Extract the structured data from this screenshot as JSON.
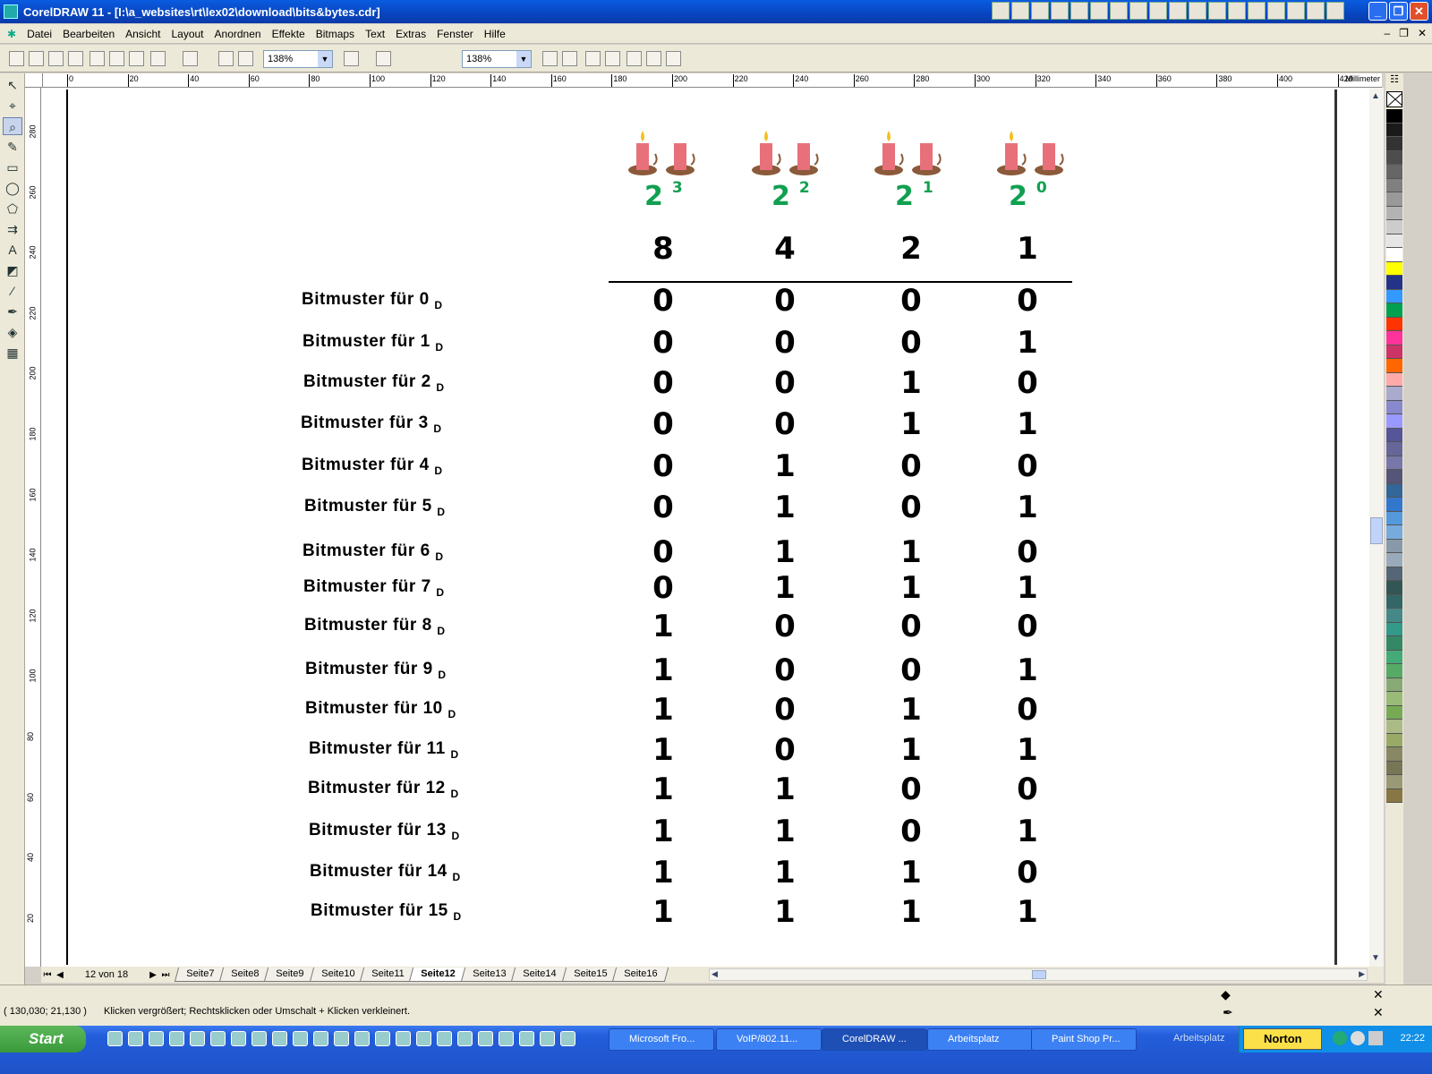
{
  "window": {
    "title": "CorelDRAW 11 - [I:\\a_websites\\rt\\lex02\\download\\bits&bytes.cdr]"
  },
  "menu": [
    "Datei",
    "Bearbeiten",
    "Ansicht",
    "Layout",
    "Anordnen",
    "Effekte",
    "Bitmaps",
    "Text",
    "Extras",
    "Fenster",
    "Hilfe"
  ],
  "toolbar": {
    "zoom1": "138%",
    "zoom2": "138%"
  },
  "ruler": {
    "unit": "Millimeter",
    "h_labels": [
      "0",
      "20",
      "40",
      "60",
      "80",
      "100",
      "120",
      "140",
      "160",
      "180",
      "200",
      "220",
      "240",
      "260",
      "280",
      "300",
      "320",
      "340",
      "360",
      "380",
      "400",
      "420"
    ],
    "v_labels": [
      "280",
      "260",
      "240",
      "220",
      "200",
      "180",
      "160",
      "140",
      "120",
      "100",
      "80",
      "60",
      "40",
      "20"
    ]
  },
  "document": {
    "powers": [
      {
        "base": "2",
        "exp": "3"
      },
      {
        "base": "2",
        "exp": "2"
      },
      {
        "base": "2",
        "exp": "1"
      },
      {
        "base": "2",
        "exp": "0"
      }
    ],
    "weights": [
      "8",
      "4",
      "2",
      "1"
    ],
    "rows": [
      {
        "label": "Bitmuster für 0",
        "sub": "D",
        "bits": [
          "0",
          "0",
          "0",
          "0"
        ]
      },
      {
        "label": "Bitmuster für 1",
        "sub": "D",
        "bits": [
          "0",
          "0",
          "0",
          "1"
        ]
      },
      {
        "label": "Bitmuster für 2",
        "sub": "D",
        "bits": [
          "0",
          "0",
          "1",
          "0"
        ]
      },
      {
        "label": "Bitmuster für 3",
        "sub": "D",
        "bits": [
          "0",
          "0",
          "1",
          "1"
        ]
      },
      {
        "label": "Bitmuster für 4",
        "sub": "D",
        "bits": [
          "0",
          "1",
          "0",
          "0"
        ]
      },
      {
        "label": "Bitmuster für 5",
        "sub": "D",
        "bits": [
          "0",
          "1",
          "0",
          "1"
        ]
      },
      {
        "label": "Bitmuster für 6",
        "sub": "D",
        "bits": [
          "0",
          "1",
          "1",
          "0"
        ]
      },
      {
        "label": "Bitmuster für 7",
        "sub": "D",
        "bits": [
          "0",
          "1",
          "1",
          "1"
        ]
      },
      {
        "label": "Bitmuster für 8",
        "sub": "D",
        "bits": [
          "1",
          "0",
          "0",
          "0"
        ]
      },
      {
        "label": "Bitmuster für 9",
        "sub": "D",
        "bits": [
          "1",
          "0",
          "0",
          "1"
        ]
      },
      {
        "label": "Bitmuster für 10",
        "sub": "D",
        "bits": [
          "1",
          "0",
          "1",
          "0"
        ]
      },
      {
        "label": "Bitmuster für 11",
        "sub": "D",
        "bits": [
          "1",
          "0",
          "1",
          "1"
        ]
      },
      {
        "label": "Bitmuster für 12",
        "sub": "D",
        "bits": [
          "1",
          "1",
          "0",
          "0"
        ]
      },
      {
        "label": "Bitmuster für 13",
        "sub": "D",
        "bits": [
          "1",
          "1",
          "0",
          "1"
        ]
      },
      {
        "label": "Bitmuster für 14",
        "sub": "D",
        "bits": [
          "1",
          "1",
          "1",
          "0"
        ]
      },
      {
        "label": "Bitmuster für 15",
        "sub": "D",
        "bits": [
          "1",
          "1",
          "1",
          "1"
        ]
      }
    ]
  },
  "pagenav": {
    "counter": "12 von 18",
    "tabs": [
      "Seite7",
      "Seite8",
      "Seite9",
      "Seite10",
      "Seite11",
      "Seite12",
      "Seite13",
      "Seite14",
      "Seite15",
      "Seite16"
    ],
    "active": "Seite12"
  },
  "status": {
    "coords": "( 130,030; 21,130 )",
    "hint": "Klicken vergrößert; Rechtsklicken oder Umschalt + Klicken verkleinert."
  },
  "taskbar": {
    "start": "Start",
    "tasks": [
      "Microsoft Fro...",
      "VoIP/802.11...",
      "CorelDRAW ...",
      "Arbeitsplatz",
      "Paint Shop Pr..."
    ],
    "active_task": "CorelDRAW ...",
    "tray_label": "Arbeitsplatz",
    "norton": "Norton",
    "clock": "22:22"
  },
  "colors": {
    "title_blue": "#0845c0",
    "power_green": "#10a050",
    "taskbar_blue": "#245edb"
  }
}
